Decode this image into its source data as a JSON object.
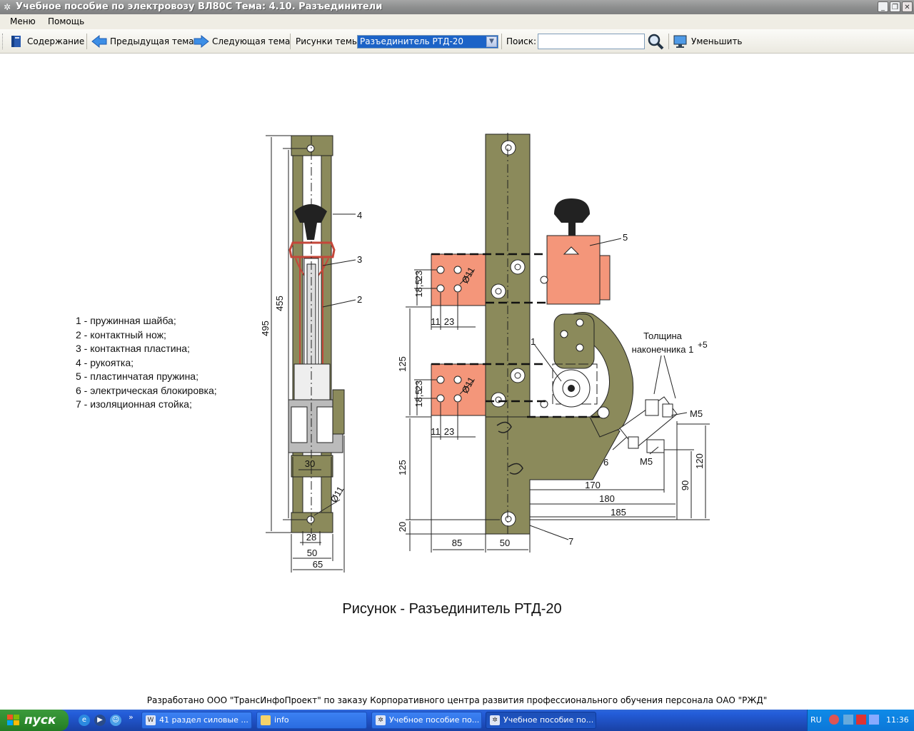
{
  "window": {
    "title": "Учебное пособие по электровозу ВЛ80С Тема: 4.10. Разъединители"
  },
  "menu": {
    "items": [
      "Меню",
      "Помощь"
    ]
  },
  "toolbar": {
    "contents_label": "Содержание",
    "prev_label": "Предыдущая тема",
    "next_label": "Следующая тема",
    "figures_label": "Рисунки темы",
    "figures_selected": "Разъединитель РТД-20",
    "search_label": "Поиск:",
    "search_value": "",
    "shrink_label": "Уменьшить"
  },
  "legend": [
    "1 - пружинная шайба;",
    "2 - контактный нож;",
    "3 - контактная пластина;",
    "4 - рукоятка;",
    "5 - пластинчатая пружина;",
    "6 - электрическая блокировка;",
    "7 - изоляционная стойка;"
  ],
  "drawing": {
    "callouts": [
      "1",
      "2",
      "3",
      "4",
      "5",
      "6",
      "7"
    ],
    "dims_left": [
      "495",
      "455",
      "30",
      "28",
      "50",
      "65",
      "Ø11"
    ],
    "dims_right": [
      "18,5",
      "23",
      "11",
      "23",
      "125",
      "18,5",
      "23",
      "11",
      "23",
      "125",
      "20",
      "85",
      "50",
      "170",
      "180",
      "185",
      "90",
      "120",
      "Ø11",
      "Ø11"
    ],
    "thickness_note_1": "Толщина",
    "thickness_note_2": "наконечника 1",
    "thickness_sup": "+5",
    "m5_a": "М5",
    "m5_b": "М5"
  },
  "caption": "Рисунок - Разъединитель РТД-20",
  "footer": "Разработано ООО \"ТрансИнфоПроект\" по заказу Корпоративного центра развития профессионального обучения персонала ОАО \"РЖД\"",
  "taskbar": {
    "start_label": "пуск",
    "buttons": [
      "41 раздел силовые ...",
      "info",
      "Учебное пособие по...",
      "Учебное пособие по..."
    ],
    "lang": "RU",
    "clock": "11:36"
  },
  "colors": {
    "insulator": "#8b8a5b",
    "copper": "#f4967a",
    "titlebar": "#8e8f8f"
  }
}
